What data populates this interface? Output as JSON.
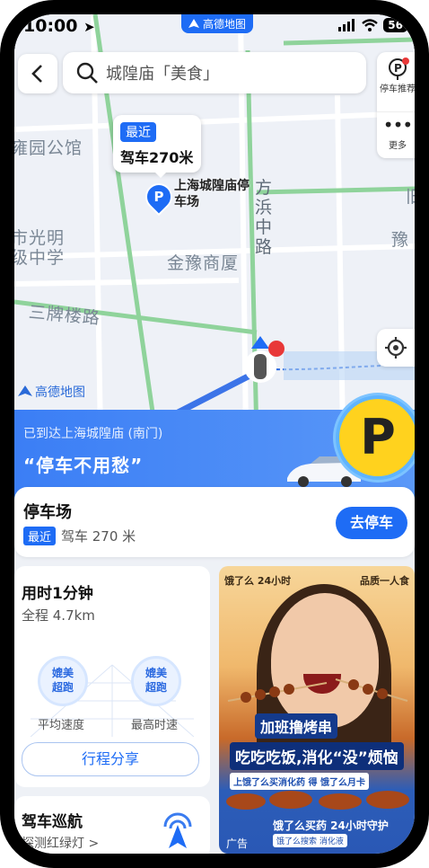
{
  "status_bar": {
    "time": "10:00",
    "battery": "56"
  },
  "brand_top": "高德地图",
  "search": {
    "query": "城隍庙「美食」"
  },
  "side_panel": {
    "parking_recommend": "停车推荐",
    "more": "更多"
  },
  "map": {
    "labels": {
      "park_street": "雍园公馆",
      "school": "市光明\n级中学",
      "block": "金豫商厦",
      "street_pailou": "三牌楼路",
      "road_fangbang": "方\n浜\n中\n路",
      "yu_right": "豫",
      "jiu_right": "旧"
    },
    "parking_bubble": {
      "badge": "最近",
      "distance": "驾车270米"
    },
    "parking_label": "上海城隍庙停\n车场",
    "logo": "高德地图"
  },
  "banner": {
    "subtitle": "已到达上海城隍庙 (南门)",
    "title": "“停车不用愁”",
    "icon": "P"
  },
  "parking_card": {
    "title": "停车场",
    "badge": "最近",
    "distance": "驾车 270 米",
    "button": "去停车"
  },
  "trip_card": {
    "title": "用时1分钟",
    "distance": "全程 4.7km",
    "avg_badge": "媲美\n超跑",
    "max_badge": "媲美\n超跑",
    "avg_label": "平均速度",
    "max_label": "最高时速",
    "share_button": "行程分享"
  },
  "cruise_card": {
    "title": "驾车巡航",
    "subtitle": "探测红绿灯 >"
  },
  "ad": {
    "brand_left": "饿了么 24小时",
    "brand_right": "品质一人食",
    "headline1": "加班撸烤串",
    "headline2": "吃吃吃饭,消化“没”烦恼",
    "subline": "上饿了么买消化药 得 饿了么月卡",
    "footer": "饿了么买药 24小时守护",
    "footer2": "饿了么搜索 消化液",
    "label": "广告"
  },
  "colors": {
    "accent": "#1e6cf5",
    "map_bg": "#eef1f7",
    "road_green": "#8fd39b"
  }
}
